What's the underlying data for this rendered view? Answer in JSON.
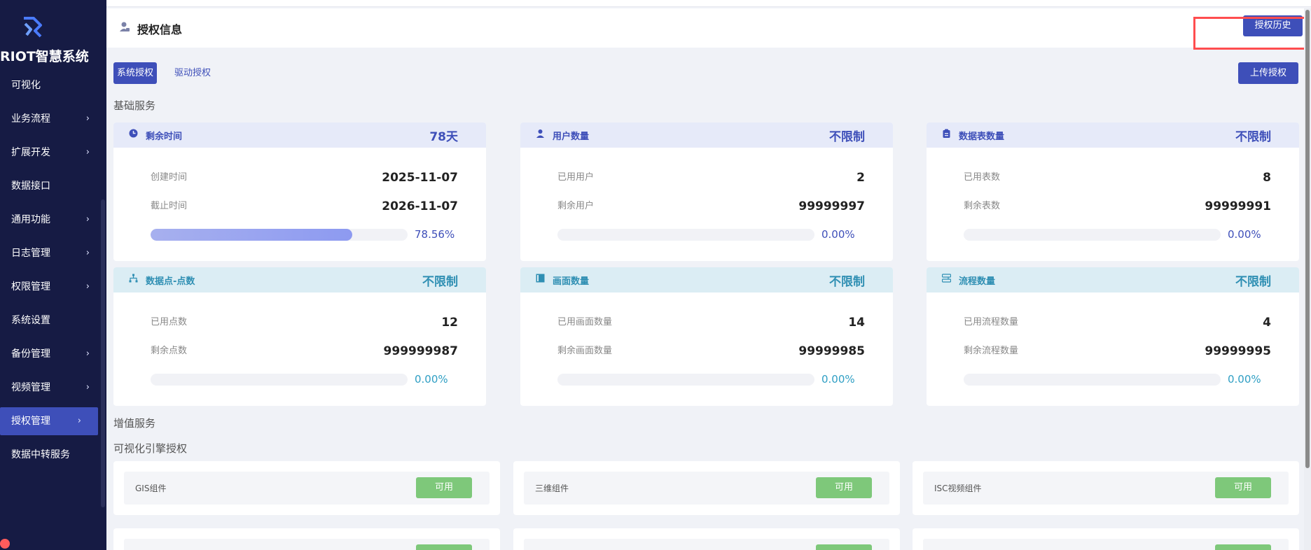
{
  "sidebar": {
    "brand": "RIOT智慧系统",
    "items": [
      {
        "label": "可视化",
        "chevron": false
      },
      {
        "label": "业务流程",
        "chevron": true
      },
      {
        "label": "扩展开发",
        "chevron": true
      },
      {
        "label": "数据接口",
        "chevron": false
      },
      {
        "label": "通用功能",
        "chevron": true
      },
      {
        "label": "日志管理",
        "chevron": true
      },
      {
        "label": "权限管理",
        "chevron": true
      },
      {
        "label": "系统设置",
        "chevron": false
      },
      {
        "label": "备份管理",
        "chevron": true
      },
      {
        "label": "视频管理",
        "chevron": true
      },
      {
        "label": "授权管理",
        "chevron": true,
        "active": true
      },
      {
        "label": "数据中转服务",
        "chevron": false
      }
    ],
    "chevron_glyph": "›"
  },
  "header": {
    "title": "授权信息",
    "history_button": "授权历史"
  },
  "tabs": {
    "system": "系统授权",
    "driver": "驱动授权",
    "upload_button": "上传授权"
  },
  "sections": {
    "basic": "基础服务",
    "value_added": "增值服务",
    "engine": "可视化引擎授权"
  },
  "cards": [
    {
      "theme": "blue",
      "icon": "clock-icon",
      "label": "剩余时间",
      "value": "78天",
      "row1_label": "创建时间",
      "row1_value": "2025-11-07",
      "row2_label": "截止时间",
      "row2_value": "2026-11-07",
      "progress": 0.7856,
      "percent": "78.56%"
    },
    {
      "theme": "blue",
      "icon": "user-icon",
      "label": "用户数量",
      "value": "不限制",
      "row1_label": "已用用户",
      "row1_value": "2",
      "row2_label": "剩余用户",
      "row2_value": "99999997",
      "progress": 0,
      "percent": "0.00%"
    },
    {
      "theme": "blue",
      "icon": "clipboard-icon",
      "label": "数据表数量",
      "value": "不限制",
      "row1_label": "已用表数",
      "row1_value": "8",
      "row2_label": "剩余表数",
      "row2_value": "99999991",
      "progress": 0,
      "percent": "0.00%"
    },
    {
      "theme": "teal",
      "icon": "network-icon",
      "label": "数据点-点数",
      "value": "不限制",
      "row1_label": "已用点数",
      "row1_value": "12",
      "row2_label": "剩余点数",
      "row2_value": "999999987",
      "progress": 0,
      "percent": "0.00%"
    },
    {
      "theme": "teal",
      "icon": "screen-icon",
      "label": "画面数量",
      "value": "不限制",
      "row1_label": "已用画面数量",
      "row1_value": "14",
      "row2_label": "剩余画面数量",
      "row2_value": "99999985",
      "progress": 0,
      "percent": "0.00%"
    },
    {
      "theme": "teal",
      "icon": "flow-icon",
      "label": "流程数量",
      "value": "不限制",
      "row1_label": "已用流程数量",
      "row1_value": "4",
      "row2_label": "剩余流程数量",
      "row2_value": "99999995",
      "progress": 0,
      "percent": "0.00%"
    }
  ],
  "components": [
    {
      "label": "GIS组件",
      "status": "可用"
    },
    {
      "label": "三维组件",
      "status": "可用"
    },
    {
      "label": "ISC视频组件",
      "status": "可用"
    }
  ],
  "colors": {
    "sidebar_bg": "#161b44",
    "primary": "#3e4fb9",
    "teal": "#2f8fb3",
    "available": "#7ec87a",
    "highlight": "#ff4d4f"
  }
}
